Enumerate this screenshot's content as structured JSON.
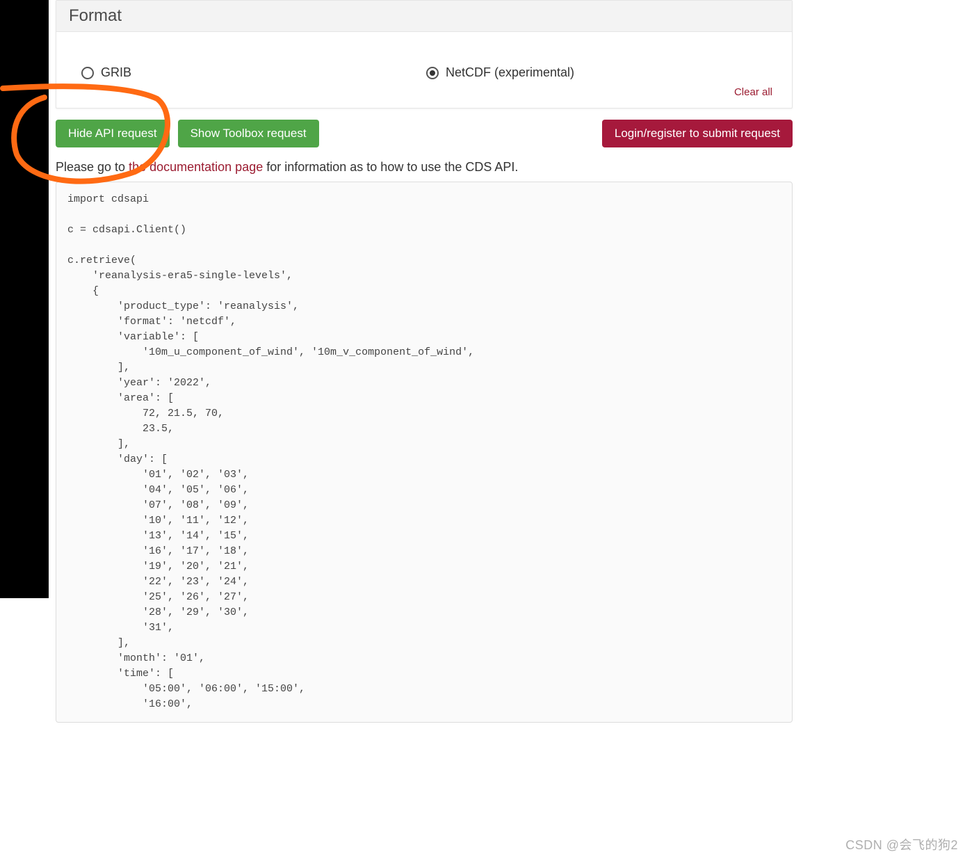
{
  "panel": {
    "title": "Format",
    "options": {
      "grib": "GRIB",
      "netcdf": "NetCDF (experimental)"
    },
    "clear_all": "Clear all"
  },
  "buttons": {
    "hide_api": "Hide API request",
    "show_toolbox": "Show Toolbox request",
    "login": "Login/register to submit request"
  },
  "instruction": {
    "prefix": "Please go to ",
    "link": "the documentation page",
    "suffix": " for information as to how to use the CDS API."
  },
  "code": "import cdsapi\n\nc = cdsapi.Client()\n\nc.retrieve(\n    'reanalysis-era5-single-levels',\n    {\n        'product_type': 'reanalysis',\n        'format': 'netcdf',\n        'variable': [\n            '10m_u_component_of_wind', '10m_v_component_of_wind',\n        ],\n        'year': '2022',\n        'area': [\n            72, 21.5, 70,\n            23.5,\n        ],\n        'day': [\n            '01', '02', '03',\n            '04', '05', '06',\n            '07', '08', '09',\n            '10', '11', '12',\n            '13', '14', '15',\n            '16', '17', '18',\n            '19', '20', '21',\n            '22', '23', '24',\n            '25', '26', '27',\n            '28', '29', '30',\n            '31',\n        ],\n        'month': '01',\n        'time': [\n            '05:00', '06:00', '15:00',\n            '16:00',",
  "watermark": "CSDN @会飞的狗2"
}
